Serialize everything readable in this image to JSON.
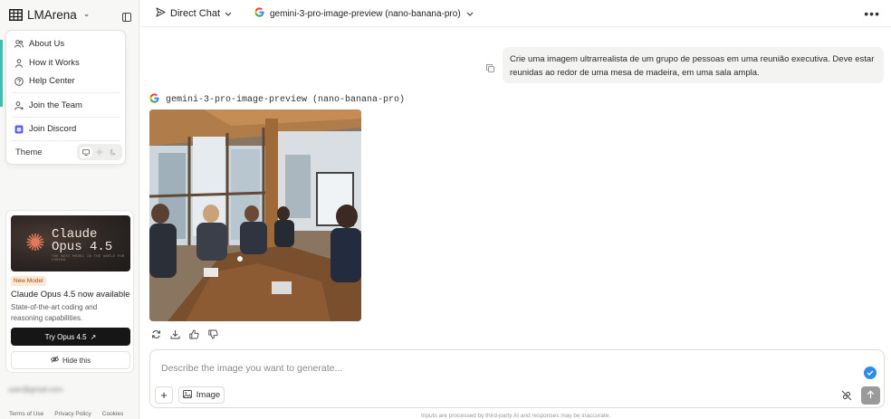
{
  "brand": {
    "name": "LMArena"
  },
  "menu": {
    "items": [
      {
        "label": "About Us",
        "icon": "users-icon"
      },
      {
        "label": "How it Works",
        "icon": "person-icon"
      },
      {
        "label": "Help Center",
        "icon": "help-circle-icon"
      },
      {
        "label": "Join the Team",
        "icon": "user-plus-icon"
      },
      {
        "label": "Join Discord",
        "icon": "discord-icon"
      }
    ],
    "theme_label": "Theme",
    "theme_options": [
      "monitor-icon",
      "sun-icon",
      "moon-icon"
    ]
  },
  "promo": {
    "image_title_line1": "Claude",
    "image_title_line2": "Opus 4.5",
    "image_tagline": "THE BEST MODEL IN THE WORLD FOR CODING",
    "badge": "New Model",
    "headline": "Claude Opus 4.5 now available",
    "description": "State-of-the-art coding and reasoning capabilities.",
    "cta_label": "Try Opus 4.5",
    "hide_label": "Hide this"
  },
  "user": {
    "email": "user@gmail.com"
  },
  "footer": {
    "links": [
      "Terms of Use",
      "Privacy Policy",
      "Cookies"
    ]
  },
  "topbar": {
    "mode": "Direct Chat",
    "model": "gemini-3-pro-image-preview (nano-banana-pro)"
  },
  "chat": {
    "user_message": "Crie uma imagem ultrarrealista de um grupo de pessoas em uma reunião executiva. Deve estar reunidas ao redor de uma mesa de madeira, em uma sala ampla.",
    "response_model": "gemini-3-pro-image-preview (nano-banana-pro)"
  },
  "composer": {
    "placeholder": "Describe the image you want to generate...",
    "image_button_label": "Image"
  },
  "disclaimer": "Inputs are processed by third-party AI and responses may be inaccurate.",
  "colors": {
    "accent": "#3bbfb0",
    "send_disabled": "#9a9a9a",
    "check": "#2d8bf0"
  }
}
